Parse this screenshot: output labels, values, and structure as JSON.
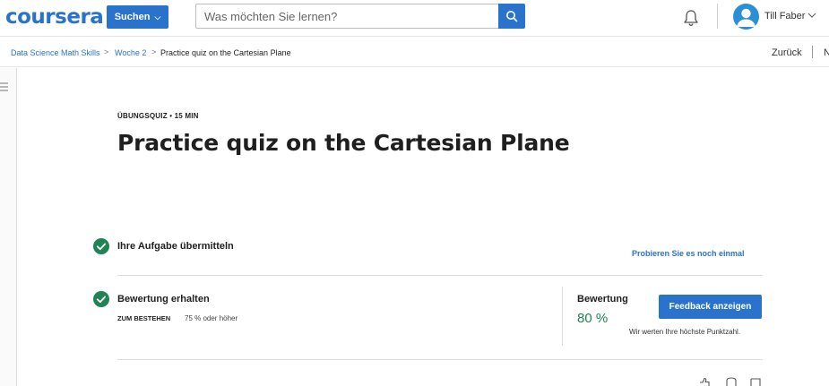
{
  "header": {
    "logo": "coursera",
    "search_button_label": "Suchen",
    "search_placeholder": "Was möchten Sie lernen?",
    "user_name": "Till Faber",
    "brand_color": "#2a73cc"
  },
  "breadcrumb": {
    "items": [
      "Data Science Math Skills",
      "Woche 2",
      "Practice quiz on the Cartesian Plane"
    ],
    "separator": ">",
    "back_label": "Zurück",
    "next_label": "N"
  },
  "quiz": {
    "eyebrow": "ÜBUNGSQUIZ • 15 MIN",
    "title": "Practice quiz on the Cartesian Plane",
    "step1_label": "Ihre Aufgabe übermitteln",
    "retry_label": "Probieren Sie es noch einmal",
    "step2_label": "Bewertung erhalten",
    "pass_key": "ZUM BESTEHEN",
    "pass_value": "75 % oder höher",
    "grade_label": "Bewertung",
    "grade_value": "80 %",
    "feedback_button": "Feedback anzeigen",
    "grade_note": "Wir werten Ihre höchste Punktzahl.",
    "success_color": "#1f8354"
  }
}
